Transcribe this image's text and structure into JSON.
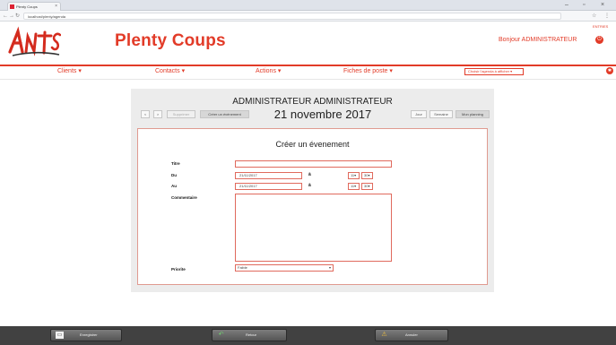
{
  "browser": {
    "tab_title": "Plenty Coups",
    "tab_close": "×",
    "url": "localhost/plenty/agenda"
  },
  "header": {
    "site_title": "Plenty Coups",
    "greeting": "Bonjour ADMINISTRATEUR",
    "side_note": "ENTRIES",
    "logout_icon": "power-icon"
  },
  "menu": {
    "items": [
      "Clients",
      "Contacts",
      "Actions",
      "Fiches de poste"
    ],
    "right_select": "Choisir l'agenda à afficher",
    "accent_color": "#e23b28"
  },
  "toolbar": {
    "prev": "<",
    "next": ">",
    "delete": "Supprimer",
    "create_event": "Créer un événement",
    "view_day": "Jour",
    "view_week": "Semaine",
    "view_month": "Mon planning"
  },
  "calendar": {
    "user_name": "ADMINISTRATEUR ADMINISTRATEUR",
    "date": "21 novembre 2017"
  },
  "form": {
    "title": "Créer un évenement",
    "title_label": "Titre",
    "from_label": "Du",
    "to_label": "Au",
    "at_label": "à",
    "from_date": "21/11/2017",
    "to_date": "21/11/2017",
    "from_hour": "11",
    "from_minute": "30",
    "to_hour": "11",
    "to_minute": "30",
    "comment_label": "Commentaire",
    "priority_label": "Priorite",
    "priority_value": "Faible"
  },
  "footer": {
    "save": "Enregistrer",
    "back": "Retour",
    "cancel": "Annuler"
  }
}
